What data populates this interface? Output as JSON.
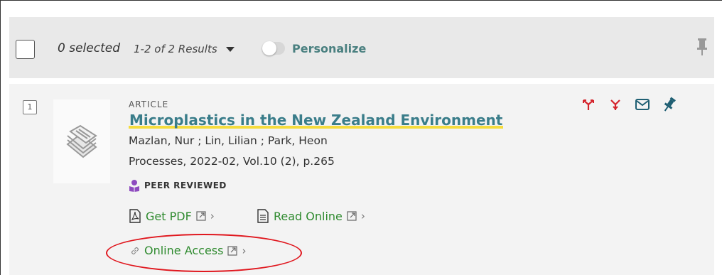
{
  "toolbar": {
    "selected": "0 selected",
    "results": "1-2 of 2 Results",
    "personalize": "Personalize",
    "pin_icon": "pin-icon"
  },
  "record": {
    "number": "1",
    "type": "ARTICLE",
    "title": "Microplastics in the New Zealand Environment",
    "authors": "Mazlan, Nur ; Lin, Lilian ; Park, Heon",
    "source": "Processes, 2022-02, Vol.10 (2), p.265",
    "peer_reviewed": "PEER REVIEWED",
    "links": {
      "get_pdf": "Get PDF",
      "read_online": "Read Online",
      "online_access": "Online Access"
    },
    "actions": [
      "cite-icon",
      "citation-trail-icon",
      "email-icon",
      "pin-icon"
    ]
  },
  "colors": {
    "accent": "#3a7d8a",
    "link": "#2e8a2e",
    "highlight": "#f5dc3d",
    "action_red": "#d4232b",
    "annotation": "#e0171e"
  }
}
